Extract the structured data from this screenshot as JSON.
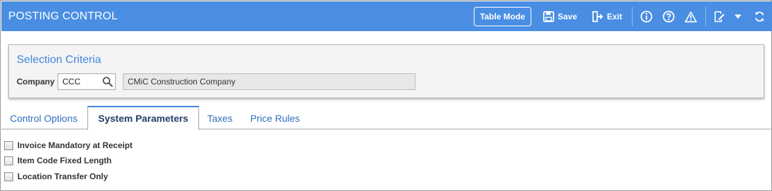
{
  "header": {
    "title": "POSTING CONTROL",
    "table_mode_label": "Table Mode",
    "save_label": "Save",
    "exit_label": "Exit",
    "icons": [
      "save-icon",
      "exit-icon",
      "info-icon",
      "help-icon",
      "warning-icon",
      "edit-icon",
      "dropdown-caret-icon",
      "refresh-icon"
    ]
  },
  "selection": {
    "title": "Selection Criteria",
    "company_label": "Company",
    "company_code": "CCC",
    "company_name": "CMiC Construction Company"
  },
  "tabs": [
    {
      "label": "Control Options",
      "active": false
    },
    {
      "label": "System Parameters",
      "active": true
    },
    {
      "label": "Taxes",
      "active": false
    },
    {
      "label": "Price Rules",
      "active": false
    }
  ],
  "parameters": [
    {
      "label": "Invoice Mandatory at Receipt",
      "checked": false
    },
    {
      "label": "Item Code Fixed Length",
      "checked": false
    },
    {
      "label": "Location Transfer Only",
      "checked": false
    }
  ],
  "colors": {
    "header_bg": "#4a8ee3",
    "accent_text": "#3f86dc"
  }
}
